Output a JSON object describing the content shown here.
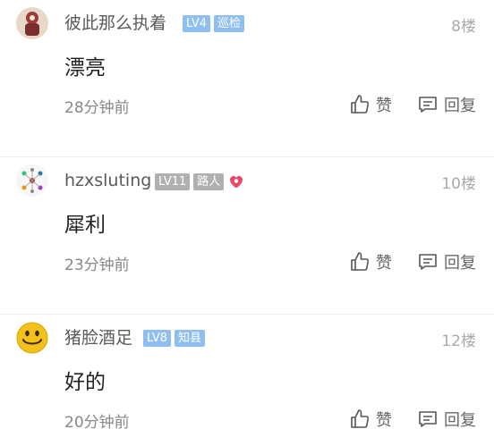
{
  "comments": [
    {
      "username": "彼此那么执着",
      "badges": [
        {
          "text": "LV4",
          "color": "#8fbff0"
        },
        {
          "text": "巡检",
          "color": "#8fbff0"
        }
      ],
      "floor": "8楼",
      "content": "漂亮",
      "time": "28分钟前",
      "like_label": "赞",
      "reply_label": "回复"
    },
    {
      "username": "hzxsluting",
      "badges": [
        {
          "text": "LV11",
          "color": "#b0b0b0"
        },
        {
          "text": "路人",
          "color": "#b0b0b0"
        }
      ],
      "floor": "10楼",
      "content": "犀利",
      "time": "23分钟前",
      "like_label": "赞",
      "reply_label": "回复"
    },
    {
      "username": "猪脸酒足",
      "badges": [
        {
          "text": "LV8",
          "color": "#8fbff0"
        },
        {
          "text": "知县",
          "color": "#8fbff0"
        }
      ],
      "floor": "12楼",
      "content": "好的",
      "time": "20分钟前",
      "like_label": "赞",
      "reply_label": "回复"
    }
  ]
}
